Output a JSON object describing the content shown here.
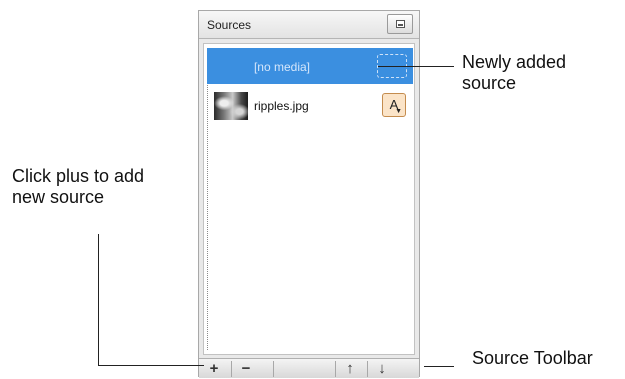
{
  "panel": {
    "title": "Sources",
    "menu_icon": "panel-menu-icon"
  },
  "sources": [
    {
      "label": "[no media]",
      "selected": true,
      "icon": "empty-source-placeholder-icon"
    },
    {
      "label": "ripples.jpg",
      "selected": false,
      "icon": "image-thumbnail",
      "option_label": "A"
    }
  ],
  "toolbar": {
    "add_label": "+",
    "remove_label": "−",
    "up_label": "↑",
    "down_label": "↓"
  },
  "annotations": {
    "new_source_line1": "Newly added",
    "new_source_line2": "source",
    "add_line1": "Click plus to add",
    "add_line2": "new source",
    "toolbar": "Source Toolbar"
  },
  "colors": {
    "selection": "#3b8fe0",
    "option_button": "#fbe4c8"
  }
}
